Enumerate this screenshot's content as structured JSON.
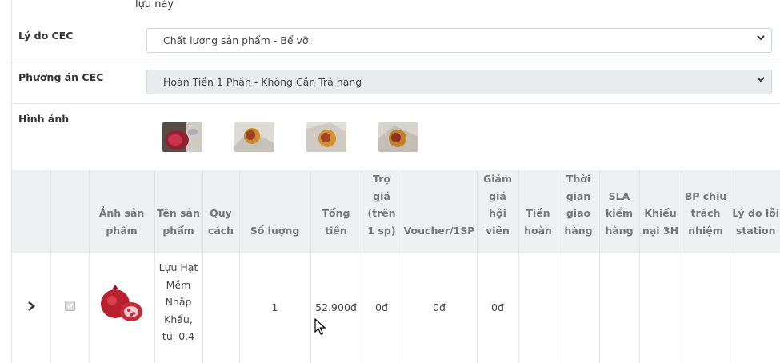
{
  "top_text": "lựu này",
  "form": {
    "reason": {
      "label": "Lý do CEC",
      "value": "Chất lượng sản phẩm - Bể vỡ."
    },
    "plan": {
      "label": "Phương án CEC",
      "value": "Hoàn Tiền 1 Phần - Không Cần Trả hàng"
    },
    "images": {
      "label": "Hình ảnh"
    }
  },
  "table": {
    "headers": [
      "",
      "",
      "Ảnh sản phẩm",
      "Tên sản phẩm",
      "Quy cách",
      "Số lượng",
      "Tổng tiền",
      "Trợ giá (trên 1 sp)",
      "Voucher/1SP",
      "Giảm giá hội viên",
      "Tiền hoàn",
      "Thời gian giao hàng",
      "SLA kiểm hàng",
      "Khiếu nại 3H",
      "BP chịu trách nhiệm",
      "Lý do lỗi station"
    ],
    "row": {
      "name": "Lựu Hạt Mềm Nhập Khẩu, túi 0.4",
      "spec": "",
      "quantity": "1",
      "total": "52.900đ",
      "subsidy": "0đ",
      "voucher": "0đ",
      "member_discount": "0đ",
      "refund": "",
      "delivery_time": "",
      "sla": "",
      "complaint": "",
      "responsible": "",
      "station_reason": ""
    }
  },
  "icons": [
    "chevron-down-icon",
    "chevron-right-icon",
    "checkbox-icon",
    "mouse-cursor-icon"
  ]
}
